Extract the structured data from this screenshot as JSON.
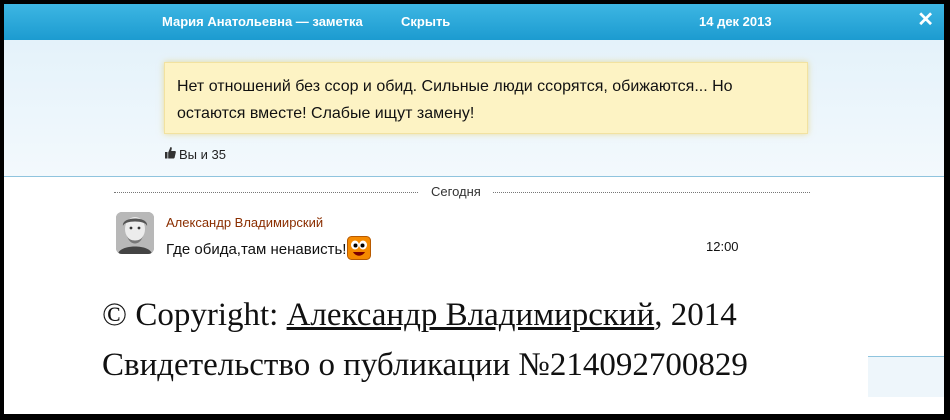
{
  "header": {
    "title": "Мария Анатольевна — заметка",
    "hide_label": "Скрыть",
    "date": "14 дек 2013",
    "close_glyph": "✕"
  },
  "note": {
    "text": "Нет отношений без ссор и обид. Сильные люди ссорятся, обижаются... Но остаются вместе! Слабые ищут замену!"
  },
  "likes": {
    "text": "Вы и 35"
  },
  "separator": {
    "label": "Сегодня"
  },
  "comment": {
    "author": "Александр Владимирский",
    "text": "Где обида,там ненависть!",
    "time": "12:00"
  },
  "copyright": {
    "prefix": "© Copyright: ",
    "author": "Александр Владимирский",
    "year": ", 2014",
    "line2": "Свидетельство о публикации №214092700829"
  }
}
